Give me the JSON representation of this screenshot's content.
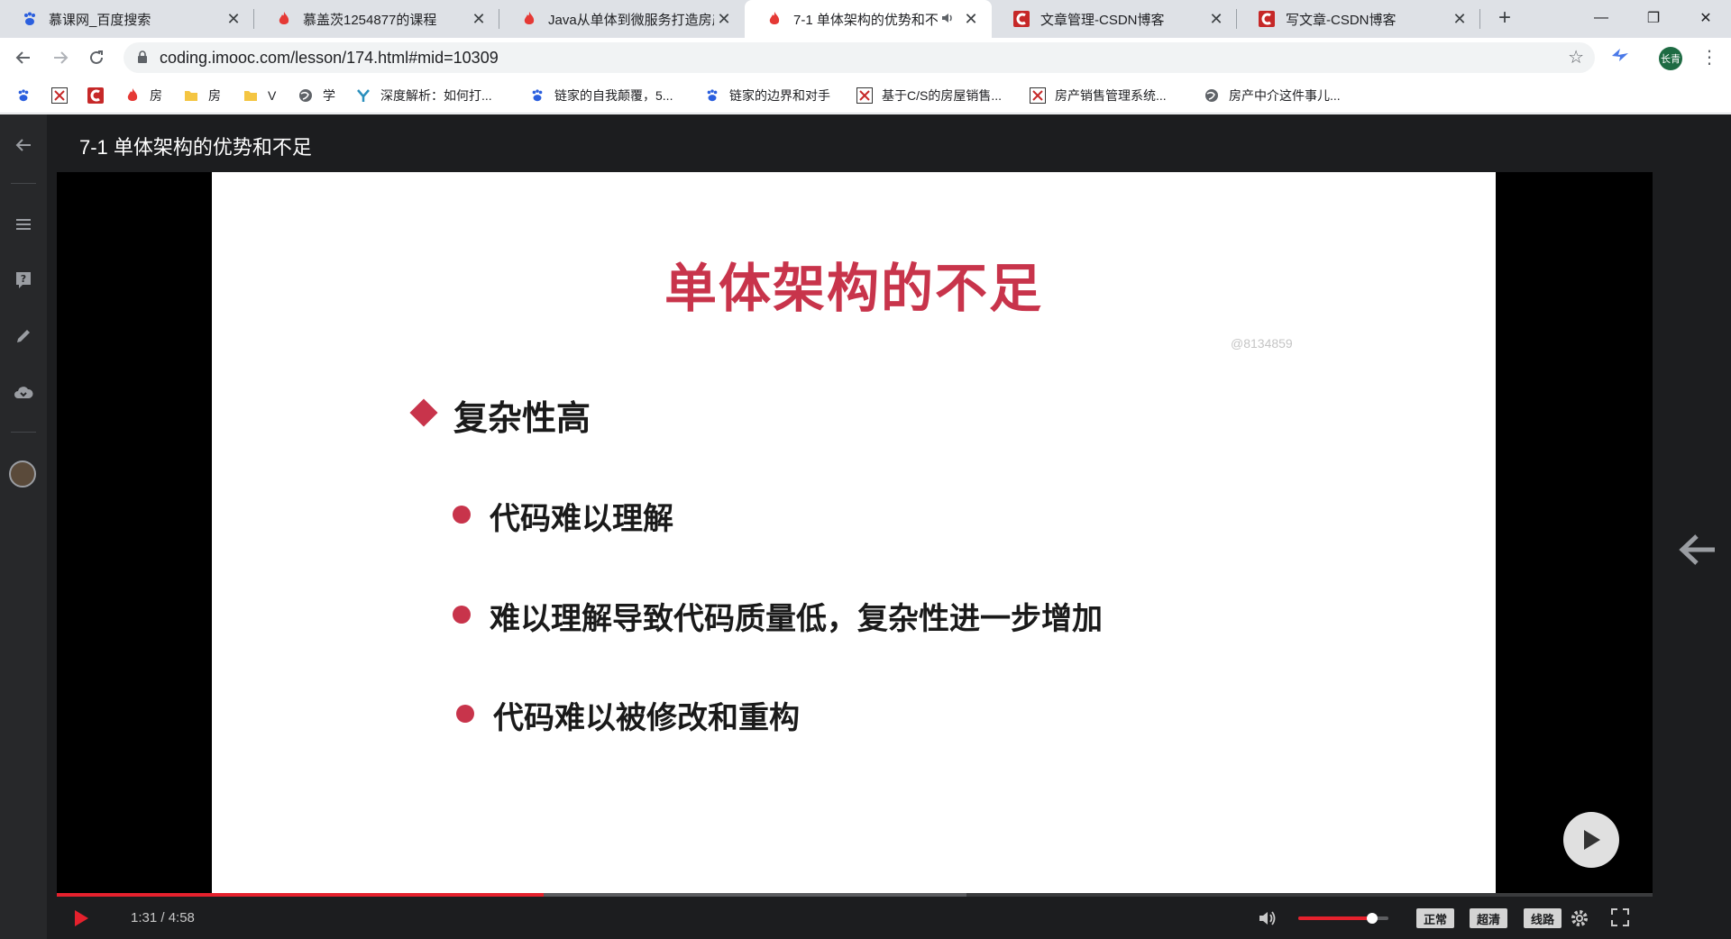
{
  "browser": {
    "tabs": [
      {
        "title": "慕课网_百度搜索",
        "icon": "baidu-paw-icon",
        "active": false
      },
      {
        "title": "慕盖茨1254877的课程",
        "icon": "imooc-flame-icon",
        "active": false
      },
      {
        "title": "Java从单体到微服务打造房产",
        "icon": "imooc-flame-icon",
        "active": false
      },
      {
        "title": "7-1 单体架构的优势和不",
        "icon": "imooc-flame-icon",
        "active": true,
        "audio": true
      },
      {
        "title": "文章管理-CSDN博客",
        "icon": "csdn-icon",
        "active": false
      },
      {
        "title": "写文章-CSDN博客",
        "icon": "csdn-icon",
        "active": false
      }
    ],
    "tab_close_glyph": "✕",
    "new_tab_glyph": "+",
    "window_controls": {
      "minimize": "—",
      "maximize": "❐",
      "close": "✕"
    },
    "address": {
      "url": "coding.imooc.com/lesson/174.html#mid=10309"
    },
    "profile_label": "长青",
    "bookmarks": [
      {
        "label": "",
        "icon": "baidu-paw-icon"
      },
      {
        "label": "",
        "icon": "site-logo-icon"
      },
      {
        "label": "",
        "icon": "csdn-icon"
      },
      {
        "label": "房",
        "icon": "imooc-flame-icon"
      },
      {
        "label": "房",
        "icon": "folder-icon"
      },
      {
        "label": "V",
        "icon": "folder-icon"
      },
      {
        "label": "学",
        "icon": "globe-icon"
      },
      {
        "label": "深度解析：如何打...",
        "icon": "y-logo-icon"
      },
      {
        "label": "链家的自我颠覆，5...",
        "icon": "baidu-paw-icon"
      },
      {
        "label": "链家的边界和对手",
        "icon": "baidu-paw-icon"
      },
      {
        "label": "基于C/S的房屋销售...",
        "icon": "site-logo-icon"
      },
      {
        "label": "房产销售管理系统...",
        "icon": "site-logo-icon"
      },
      {
        "label": "房产中介这件事儿...",
        "icon": "globe-icon"
      }
    ]
  },
  "lesson": {
    "title": "7-1 单体架构的优势和不足"
  },
  "slide": {
    "heading": "单体架构的不足",
    "watermark": "@8134859",
    "main_point": "复杂性高",
    "sub_points": [
      "代码难以理解",
      "难以理解导致代码质量低，复杂性进一步增加",
      "代码难以被修改和重构"
    ]
  },
  "player": {
    "time_display": "1:31 / 4:58",
    "played_fraction": 0.305,
    "buffered_fraction": 0.57,
    "volume_fraction": 0.82,
    "quality_buttons": [
      "正常",
      "超清",
      "线路"
    ]
  },
  "colors": {
    "accent_red": "#c8344b",
    "progress_red": "#e5212d",
    "page_dark": "#1c1d1f"
  }
}
